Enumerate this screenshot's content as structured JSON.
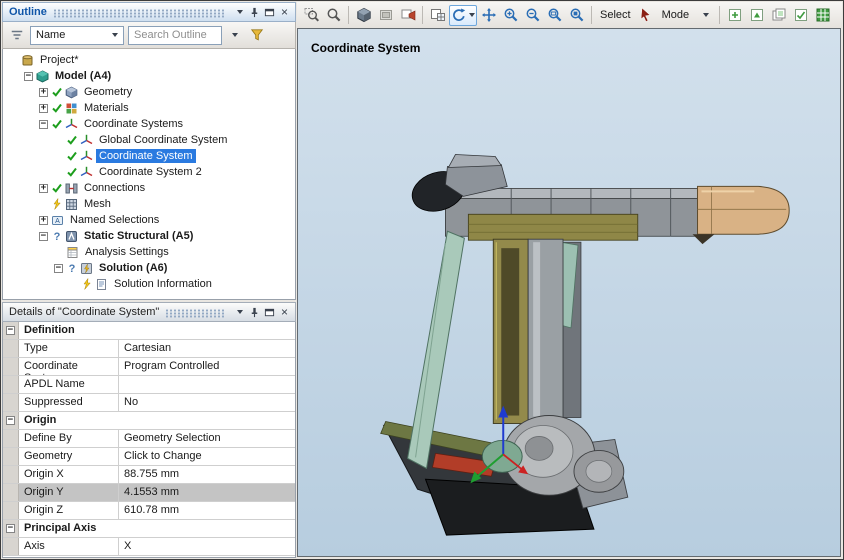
{
  "theme": {
    "selection_blue": "#2a7ae0",
    "header_title_blue": "#0f55a8",
    "viewport_bg_top": "#d2e0ec",
    "viewport_bg_bottom": "#b7cddf"
  },
  "outline": {
    "title": "Outline",
    "toolbar": {
      "name_label": "Name",
      "search_placeholder": "Search Outline"
    },
    "tree": [
      {
        "label": "Project*",
        "level": 0,
        "icon": "project"
      },
      {
        "label": "Model (A4)",
        "level": 1,
        "icon": "model",
        "expand": "minus",
        "bold": true
      },
      {
        "label": "Geometry",
        "level": 2,
        "icon": "geometry",
        "expand": "plus",
        "status": "check"
      },
      {
        "label": "Materials",
        "level": 2,
        "icon": "materials",
        "expand": "plus",
        "status": "check"
      },
      {
        "label": "Coordinate Systems",
        "level": 2,
        "icon": "csys",
        "expand": "minus",
        "status": "check"
      },
      {
        "label": "Global Coordinate System",
        "level": 3,
        "icon": "csys",
        "status": "check"
      },
      {
        "label": "Coordinate System",
        "level": 3,
        "icon": "csys",
        "status": "check",
        "selected": true
      },
      {
        "label": "Coordinate System 2",
        "level": 3,
        "icon": "csys",
        "status": "check"
      },
      {
        "label": "Connections",
        "level": 2,
        "icon": "connections",
        "expand": "plus",
        "status": "check"
      },
      {
        "label": "Mesh",
        "level": 2,
        "icon": "mesh",
        "status": "bolt"
      },
      {
        "label": "Named Selections",
        "level": 2,
        "icon": "namedsel",
        "expand": "plus"
      },
      {
        "label": "Static Structural (A5)",
        "level": 2,
        "icon": "static",
        "expand": "minus",
        "status": "question",
        "bold": true
      },
      {
        "label": "Analysis Settings",
        "level": 3,
        "icon": "analysis"
      },
      {
        "label": "Solution (A6)",
        "level": 3,
        "icon": "solution",
        "expand": "minus",
        "status": "question",
        "bold": true
      },
      {
        "label": "Solution Information",
        "level": 4,
        "icon": "solinfo",
        "status": "bolt"
      }
    ]
  },
  "details": {
    "title": "Details of \"Coordinate System\"",
    "rows": [
      {
        "type": "section",
        "label": "Definition"
      },
      {
        "type": "row",
        "label": "Type",
        "value": "Cartesian"
      },
      {
        "type": "row",
        "label": "Coordinate System",
        "value": "Program Controlled"
      },
      {
        "type": "row",
        "label": "APDL Name",
        "value": ""
      },
      {
        "type": "row",
        "label": "Suppressed",
        "value": "No"
      },
      {
        "type": "section",
        "label": "Origin"
      },
      {
        "type": "row",
        "label": "Define By",
        "value": "Geometry Selection"
      },
      {
        "type": "row",
        "label": "Geometry",
        "value": "Click to Change"
      },
      {
        "type": "row",
        "label": "Origin X",
        "value": "88.755 mm"
      },
      {
        "type": "row",
        "label": "Origin Y",
        "value": "4.1553 mm",
        "selected": true
      },
      {
        "type": "row",
        "label": "Origin Z",
        "value": "610.78 mm"
      },
      {
        "type": "section",
        "label": "Principal Axis"
      },
      {
        "type": "row",
        "label": "Axis",
        "value": "X"
      }
    ]
  },
  "toolbar": {
    "items": [
      {
        "type": "icon",
        "name": "zoom-box"
      },
      {
        "type": "icon",
        "name": "zoom-pointer"
      },
      {
        "type": "sep"
      },
      {
        "type": "icon",
        "name": "iso-view"
      },
      {
        "type": "icon",
        "name": "look-at"
      },
      {
        "type": "icon",
        "name": "manage-views"
      },
      {
        "type": "sep"
      },
      {
        "type": "icon",
        "name": "viewports"
      },
      {
        "type": "icon",
        "name": "rotate",
        "active": true,
        "dropdown": true
      },
      {
        "type": "icon",
        "name": "pan"
      },
      {
        "type": "icon",
        "name": "zoom-in"
      },
      {
        "type": "icon",
        "name": "zoom-out"
      },
      {
        "type": "icon",
        "name": "box-zoom"
      },
      {
        "type": "icon",
        "name": "zoom-fit"
      },
      {
        "type": "sep"
      },
      {
        "type": "text",
        "name": "select-label",
        "text": "Select"
      },
      {
        "type": "icon",
        "name": "mode-cursor"
      },
      {
        "type": "text",
        "name": "mode-label",
        "text": "Mode"
      },
      {
        "type": "icon",
        "name": "dropdown-chevron"
      },
      {
        "type": "sep"
      },
      {
        "type": "icon",
        "name": "new-figure"
      },
      {
        "type": "icon",
        "name": "image-export"
      },
      {
        "type": "icon",
        "name": "copy-pages"
      },
      {
        "type": "icon",
        "name": "tag-check"
      },
      {
        "type": "icon",
        "name": "show-mesh"
      }
    ]
  },
  "viewport": {
    "label": "Coordinate System"
  }
}
